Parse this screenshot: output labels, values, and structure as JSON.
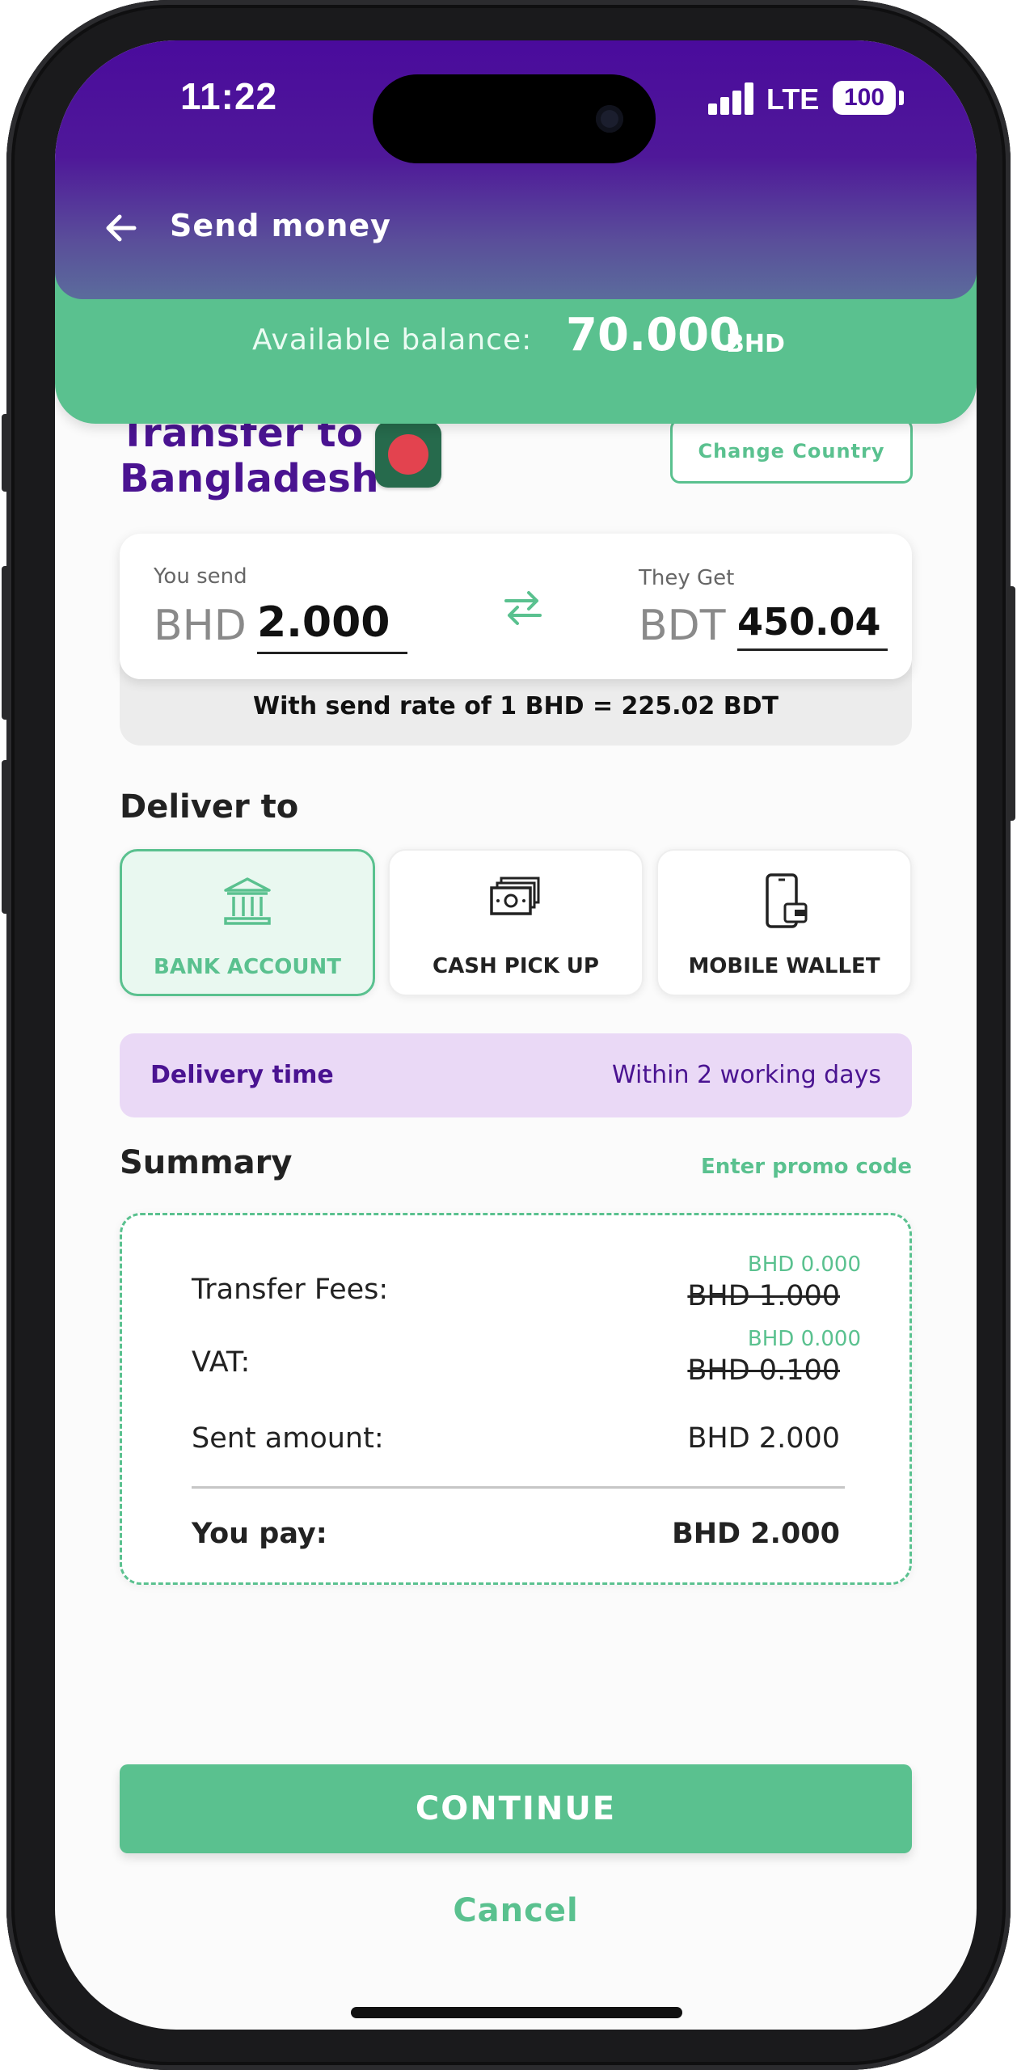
{
  "status_bar": {
    "time": "11:22",
    "network": "LTE",
    "battery": "100",
    "signal_icon": "cellular-signal-icon"
  },
  "header": {
    "title": "Send money",
    "back_icon": "arrow-left-icon"
  },
  "balance": {
    "label": "Available balance:",
    "amount": "70.000",
    "currency": "BHD"
  },
  "transfer": {
    "title_line1": "Transfer to",
    "title_line2": "Bangladesh",
    "flag_icon": "bangladesh-flag-icon",
    "change_country_label": "Change Country"
  },
  "converter": {
    "send_label": "You send",
    "send_currency": "BHD",
    "send_amount": "2.000",
    "get_label": "They Get",
    "get_currency": "BDT",
    "get_amount": "450.04",
    "swap_icon": "swap-arrows-icon",
    "rate_text": "With send rate of 1 BHD = 225.02 BDT"
  },
  "deliver": {
    "heading": "Deliver to",
    "options": [
      {
        "label": "BANK ACCOUNT",
        "icon": "bank-icon",
        "selected": true
      },
      {
        "label": "CASH PICK UP",
        "icon": "cash-icon",
        "selected": false
      },
      {
        "label": "MOBILE WALLET",
        "icon": "mobile-wallet-icon",
        "selected": false
      }
    ]
  },
  "delivery_time": {
    "label": "Delivery time",
    "value": "Within 2 working days"
  },
  "summary": {
    "heading": "Summary",
    "promo_label": "Enter promo code",
    "transfer_fees_label": "Transfer Fees:",
    "transfer_fees_new": "BHD 0.000",
    "transfer_fees_old": "BHD 1.000",
    "vat_label": "VAT:",
    "vat_new": "BHD 0.000",
    "vat_old": "BHD 0.100",
    "sent_amount_label": "Sent amount:",
    "sent_amount_value": "BHD 2.000",
    "you_pay_label": "You pay:",
    "you_pay_value": "BHD 2.000"
  },
  "actions": {
    "continue_label": "CONTINUE",
    "cancel_label": "Cancel"
  },
  "colors": {
    "brand_purple": "#4a0b9c",
    "accent_green": "#5ac18f",
    "delivery_bg": "#ead9f6"
  }
}
